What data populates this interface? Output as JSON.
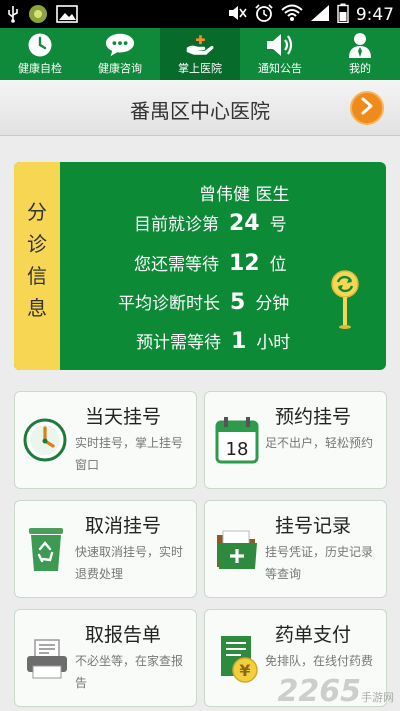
{
  "status_bar": {
    "time": "9:47"
  },
  "tabs": [
    {
      "label": "健康自检",
      "icon": "clock-icon"
    },
    {
      "label": "健康咨询",
      "icon": "chat-bubble-icon"
    },
    {
      "label": "掌上医院",
      "icon": "hand-medical-icon",
      "active": true
    },
    {
      "label": "通知公告",
      "icon": "speaker-icon"
    },
    {
      "label": "我的",
      "icon": "person-icon"
    }
  ],
  "header": {
    "title": "番禺区中心医院"
  },
  "queue": {
    "side_label": "分诊信息",
    "doctor": "曾伟健  医生",
    "current_label": "目前就诊第",
    "current_num": "24",
    "current_unit": "号",
    "wait_label": "您还需等待",
    "wait_num": "12",
    "wait_unit": "位",
    "avg_label": "平均诊断时长",
    "avg_num": "5",
    "avg_unit": "分钟",
    "est_label": "预计需等待",
    "est_num": "1",
    "est_unit": "小时"
  },
  "tiles": [
    {
      "title": "当天挂号",
      "desc": "实时挂号，掌上挂号窗口",
      "icon": "clock-icon"
    },
    {
      "title": "预约挂号",
      "desc": "足不出户，轻松预约",
      "icon": "calendar-icon",
      "date": "18"
    },
    {
      "title": "取消挂号",
      "desc": "快速取消挂号，实时退费处理",
      "icon": "recycle-bin-icon"
    },
    {
      "title": "挂号记录",
      "desc": "挂号凭证，历史记录等查询",
      "icon": "folder-plus-icon"
    },
    {
      "title": "取报告单",
      "desc": "不必坐等，在家查报告",
      "icon": "printer-icon"
    },
    {
      "title": "药单支付",
      "desc": "免排队，在线付药费",
      "icon": "bill-payment-icon"
    }
  ],
  "watermark": {
    "brand": "2265",
    "sub": "手游网"
  }
}
